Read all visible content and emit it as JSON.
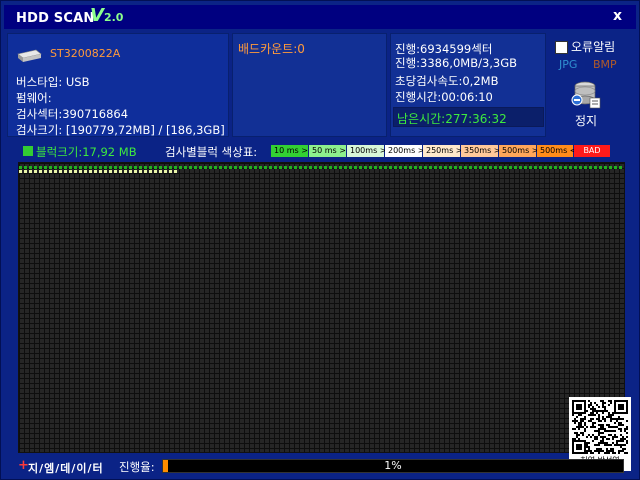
{
  "titlebar": {
    "app_name": "HDD SCAN",
    "version_big": "V",
    "version_small": "2.0",
    "close_label": "x"
  },
  "drive": {
    "model": "ST3200822A",
    "bus_type": "버스타입: USB",
    "firmware": "펌웨어:",
    "scan_sectors": "검사섹터:390716864",
    "scan_size": "검사크기: [190779,72MB] / [186,3GB]"
  },
  "bad_count": "배드카운트:0",
  "stats": {
    "progress_sectors": "진행:6934599섹터",
    "progress_mb": "진행:3386,0MB/3,3GB",
    "speed": "초당검사속도:0,2MB",
    "elapsed": "진행시간:00:06:10",
    "remaining": "남은시간:277:36:32"
  },
  "options": {
    "error_alert_label": "오류알림",
    "error_alert_checked": false,
    "jpg_label": "JPG",
    "bmp_label": "BMP",
    "stop_label": "정지"
  },
  "legend": {
    "block_size": "블럭크기:17,92 MB",
    "label": "검사별블럭 색상표:",
    "items": [
      {
        "label": "10 ms >",
        "color": "#33d133"
      },
      {
        "label": "50 ms >",
        "color": "#8df08d"
      },
      {
        "label": "100ms >",
        "color": "#d8f7d8"
      },
      {
        "label": "200ms >",
        "color": "#ffffff"
      },
      {
        "label": "250ms >",
        "color": "#ffe9cc"
      },
      {
        "label": "350ms >",
        "color": "#ffc89a"
      },
      {
        "label": "500ms >",
        "color": "#ffa65a"
      },
      {
        "label": "500ms <",
        "color": "#ff8c1a"
      },
      {
        "label": "BAD",
        "color": "#ff1a1a"
      }
    ]
  },
  "qr_caption": "허영 박선영",
  "footer": {
    "brand": "지/엠/데/이/터",
    "progress_label": "진행율:",
    "progress_text": "1%",
    "progress_fraction": 0.01
  }
}
